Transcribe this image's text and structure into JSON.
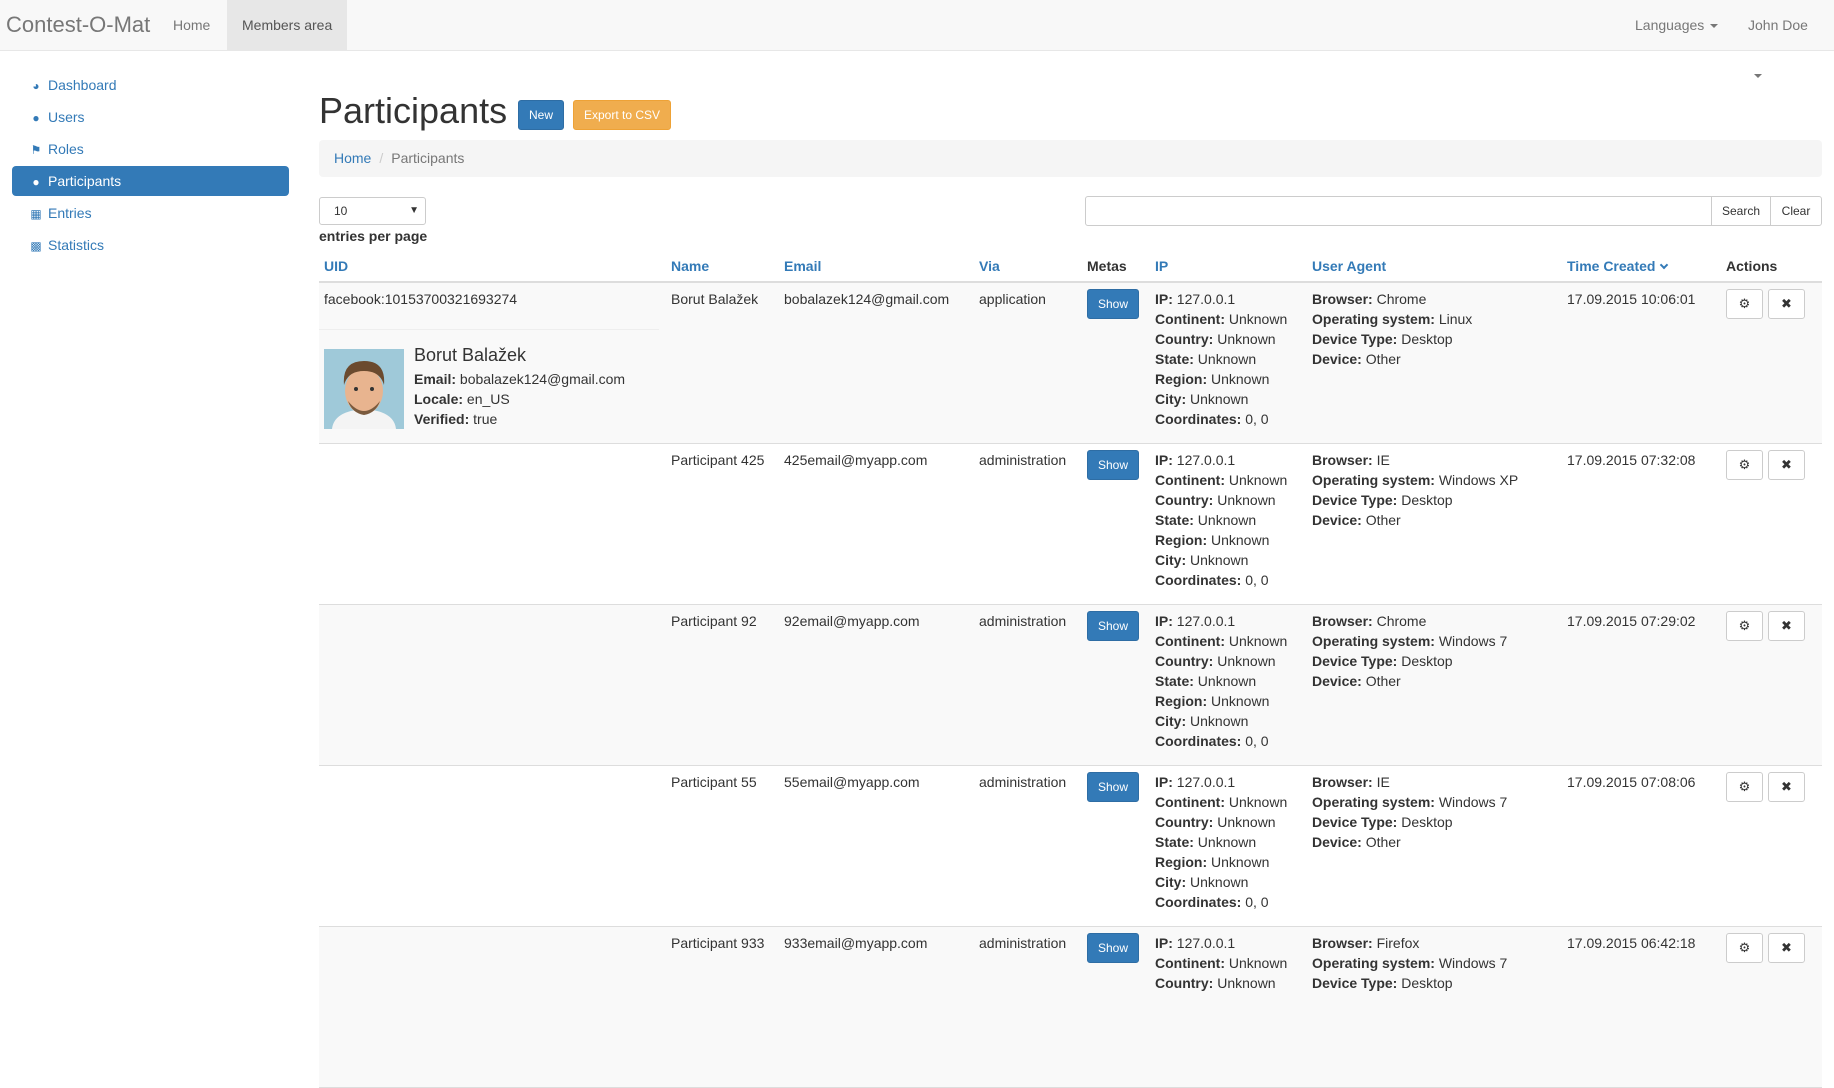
{
  "navbar": {
    "brand": "Contest-O-Mat",
    "home": "Home",
    "members_area": "Members area",
    "languages": "Languages",
    "user": "John Doe"
  },
  "sidebar": {
    "items": [
      {
        "label": "Dashboard",
        "icon": "dashboard-icon"
      },
      {
        "label": "Users",
        "icon": "user-icon"
      },
      {
        "label": "Roles",
        "icon": "tags-icon"
      },
      {
        "label": "Participants",
        "icon": "users-icon",
        "active": true
      },
      {
        "label": "Entries",
        "icon": "table-icon"
      },
      {
        "label": "Statistics",
        "icon": "bar-chart-icon"
      }
    ]
  },
  "page": {
    "title": "Participants",
    "new_label": "New",
    "export_label": "Export to CSV",
    "breadcrumb_home": "Home",
    "breadcrumb_current": "Participants",
    "per_page_value": "10",
    "per_page_label": "entries per page",
    "search_value": "",
    "search_label": "Search",
    "clear_label": "Clear"
  },
  "table": {
    "headers": {
      "uid": "UID",
      "name": "Name",
      "email": "Email",
      "via": "Via",
      "metas": "Metas",
      "ip": "IP",
      "user_agent": "User Agent",
      "time_created": "Time Created",
      "actions": "Actions"
    },
    "show_label": "Show",
    "labels": {
      "ip": "IP:",
      "continent": "Continent:",
      "country": "Country:",
      "state": "State:",
      "region": "Region:",
      "city": "City:",
      "coordinates": "Coordinates:",
      "browser": "Browser:",
      "os": "Operating system:",
      "device_type": "Device Type:",
      "device": "Device:",
      "fb_email": "Email:",
      "fb_locale": "Locale:",
      "fb_verified": "Verified:"
    },
    "rows": [
      {
        "uid": "facebook:10153700321693274",
        "fb_name": "Borut Balažek",
        "fb_email": "bobalazek124@gmail.com",
        "fb_locale": "en_US",
        "fb_verified": "true",
        "name": "Borut Balažek",
        "email": "bobalazek124@gmail.com",
        "via": "application",
        "ip": "127.0.0.1",
        "continent": "Unknown",
        "country": "Unknown",
        "state": "Unknown",
        "region": "Unknown",
        "city": "Unknown",
        "coordinates": "0, 0",
        "browser": "Chrome",
        "os": "Linux",
        "device_type": "Desktop",
        "device": "Other",
        "time": "17.09.2015 10:06:01"
      },
      {
        "uid": "",
        "name": "Participant 425",
        "email": "425email@myapp.com",
        "via": "administration",
        "ip": "127.0.0.1",
        "continent": "Unknown",
        "country": "Unknown",
        "state": "Unknown",
        "region": "Unknown",
        "city": "Unknown",
        "coordinates": "0, 0",
        "browser": "IE",
        "os": "Windows XP",
        "device_type": "Desktop",
        "device": "Other",
        "time": "17.09.2015 07:32:08"
      },
      {
        "uid": "",
        "name": "Participant 92",
        "email": "92email@myapp.com",
        "via": "administration",
        "ip": "127.0.0.1",
        "continent": "Unknown",
        "country": "Unknown",
        "state": "Unknown",
        "region": "Unknown",
        "city": "Unknown",
        "coordinates": "0, 0",
        "browser": "Chrome",
        "os": "Windows 7",
        "device_type": "Desktop",
        "device": "Other",
        "time": "17.09.2015 07:29:02"
      },
      {
        "uid": "",
        "name": "Participant 55",
        "email": "55email@myapp.com",
        "via": "administration",
        "ip": "127.0.0.1",
        "continent": "Unknown",
        "country": "Unknown",
        "state": "Unknown",
        "region": "Unknown",
        "city": "Unknown",
        "coordinates": "0, 0",
        "browser": "IE",
        "os": "Windows 7",
        "device_type": "Desktop",
        "device": "Other",
        "time": "17.09.2015 07:08:06"
      },
      {
        "uid": "",
        "name": "Participant 933",
        "email": "933email@myapp.com",
        "via": "administration",
        "ip": "127.0.0.1",
        "continent": "Unknown",
        "country": "Unknown",
        "state": "",
        "region": "",
        "city": "",
        "coordinates": "",
        "browser": "Firefox",
        "os": "Windows 7",
        "device_type": "Desktop",
        "device": "",
        "time": "17.09.2015 06:42:18"
      }
    ]
  }
}
